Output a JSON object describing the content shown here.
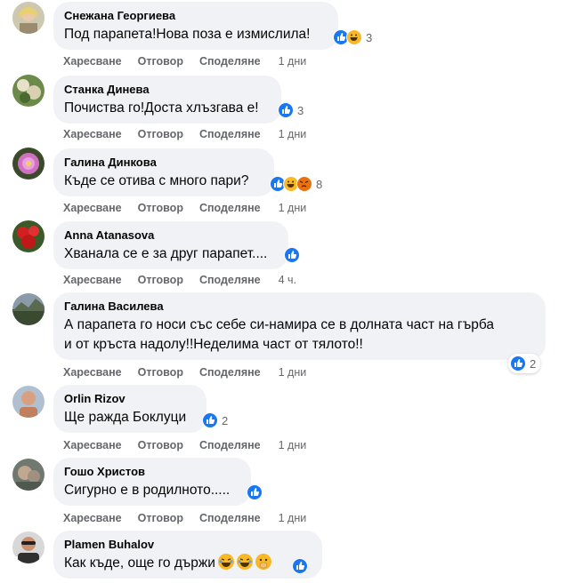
{
  "actions": {
    "like": "Харесване",
    "reply": "Отговор",
    "share": "Споделяне"
  },
  "comments": [
    {
      "author": "Снежана Георгиева",
      "text": "Под парапета!Нова поза е измислила!",
      "time": "1 дни",
      "reaction_count": "3",
      "reactions": [
        "like-icon",
        "haha-icon"
      ]
    },
    {
      "author": "Станка Динева",
      "text": "Почиства го!Доста хлъзгава е!",
      "time": "1 дни",
      "reaction_count": "3",
      "reactions": [
        "like-icon"
      ]
    },
    {
      "author": "Галина Динкова",
      "text": "Къде се отива с много пари?",
      "time": "1 дни",
      "reaction_count": "8",
      "reactions": [
        "like-icon",
        "haha-icon",
        "angry-icon"
      ]
    },
    {
      "author": "Anna Atanasova",
      "text": "Хванала се е за друг парапет....",
      "time": "4 ч.",
      "reaction_count": "",
      "reactions": [
        "like-icon"
      ]
    },
    {
      "author": "Галина Василева",
      "text_line1": "А парапета го носи със себе си-намира се в долната част на гърба",
      "text_line2": "и от кръста надолу!!Неделима част от тялото!!",
      "time": "1 дни",
      "reaction_count": "2",
      "reactions": [
        "like-icon"
      ]
    },
    {
      "author": "Orlin Rizov",
      "text": "Ще ражда Боклуци",
      "time": "1 дни",
      "reaction_count": "2",
      "reactions": [
        "like-icon"
      ]
    },
    {
      "author": "Гошо Христов",
      "text": "Сигурно е в родилното.....",
      "time": "1 дни",
      "reaction_count": "",
      "reactions": [
        "like-icon"
      ]
    },
    {
      "author": "Plamen Buhalov",
      "text": "Как къде, още го държи",
      "time": "",
      "reaction_count": "",
      "reactions": [
        "like-icon"
      ],
      "inline_emojis": [
        "laughing-tears-emoji",
        "laughing-tears-emoji",
        "hand-over-mouth-emoji"
      ]
    }
  ],
  "colors": {
    "bubble": "#f0f2f5",
    "like": "#1877f2",
    "haha": "#f7b928",
    "angry": "#e9710f",
    "meta": "#65676b"
  }
}
